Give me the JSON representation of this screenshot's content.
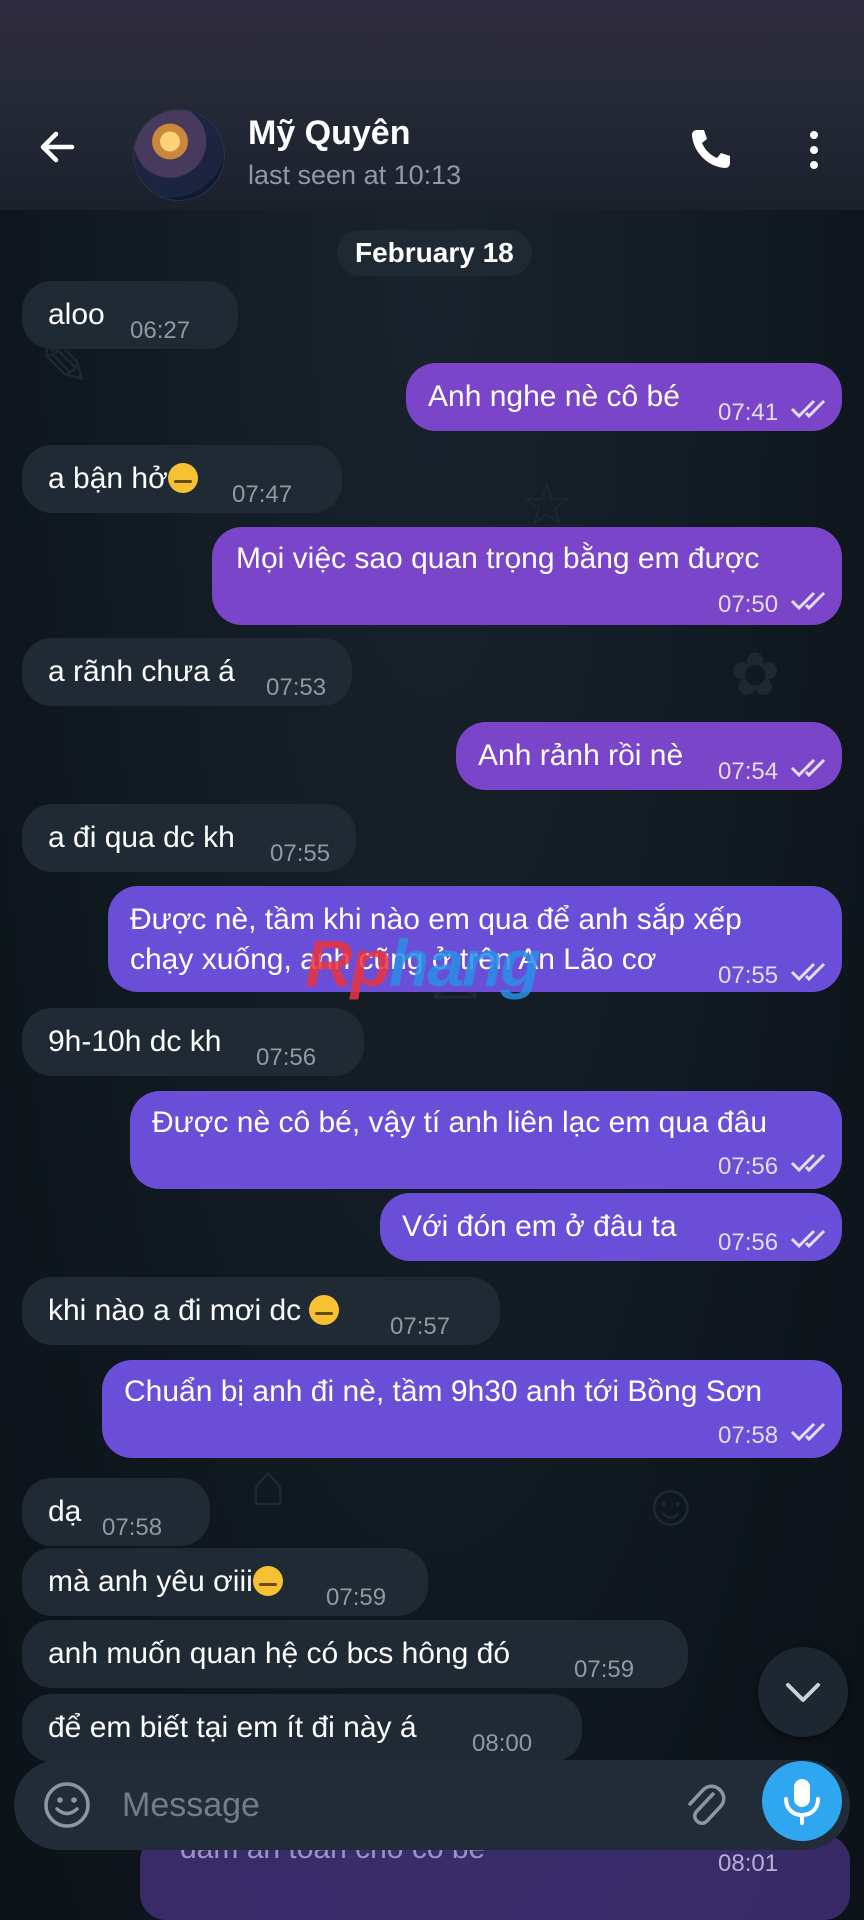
{
  "header": {
    "contact_name": "Mỹ Quyên",
    "status": "last seen at 10:13"
  },
  "date_label": "February 18",
  "messages": [
    {
      "text": "aloo",
      "time": "06:27",
      "dir": "in"
    },
    {
      "text": "Anh nghe nè cô bé",
      "time": "07:41",
      "dir": "out"
    },
    {
      "text": "a bận hở",
      "time": "07:47",
      "dir": "in"
    },
    {
      "text": "Mọi việc sao quan trọng bằng em được",
      "time": "07:50",
      "dir": "out"
    },
    {
      "text": "a rãnh chưa á",
      "time": "07:53",
      "dir": "in"
    },
    {
      "text": "Anh rảnh rồi nè",
      "time": "07:54",
      "dir": "out"
    },
    {
      "text": "a đi qua dc kh",
      "time": "07:55",
      "dir": "in"
    },
    {
      "text_line1": "Được nè, tầm khi nào em qua để anh sắp xếp",
      "text_line2": "chạy xuống, anh cũng ở trên An Lão cơ",
      "time": "07:55",
      "dir": "out"
    },
    {
      "text": "9h-10h dc kh",
      "time": "07:56",
      "dir": "in"
    },
    {
      "text": "Được nè cô bé, vậy tí anh liên lạc em qua đâu",
      "time": "07:56",
      "dir": "out"
    },
    {
      "text": "Với đón em ở đâu ta",
      "time": "07:56",
      "dir": "out"
    },
    {
      "text": "khi nào a đi mơi dc",
      "time": "07:57",
      "dir": "in"
    },
    {
      "text": "Chuẩn bị anh đi nè, tầm 9h30 anh tới Bồng Sơn",
      "time": "07:58",
      "dir": "out"
    },
    {
      "text": "dạ",
      "time": "07:58",
      "dir": "in"
    },
    {
      "text": "mà anh yêu ơiii",
      "time": "07:59",
      "dir": "in"
    },
    {
      "text": "anh muốn quan hệ có bcs hông đó",
      "time": "07:59",
      "dir": "in"
    },
    {
      "text": "để em biết tại em ít đi này á",
      "time": "08:00",
      "dir": "in"
    },
    {
      "text": "đảm an toàn cho cô bé",
      "time": "08:01",
      "dir": "out"
    }
  ],
  "watermark": {
    "part1": "Rp",
    "part2": "hang"
  },
  "input": {
    "placeholder": "Message"
  },
  "icons": {
    "back": "arrow-left-icon",
    "call": "phone-icon",
    "more": "more-vertical-icon",
    "emoji": "smiley-icon",
    "attach": "paperclip-icon",
    "mic": "microphone-icon",
    "scroll": "chevron-down-icon"
  },
  "colors": {
    "outgoing_bubble": "#7a45c9",
    "incoming_bubble": "#202a34",
    "mic_button": "#2ea6f0"
  }
}
